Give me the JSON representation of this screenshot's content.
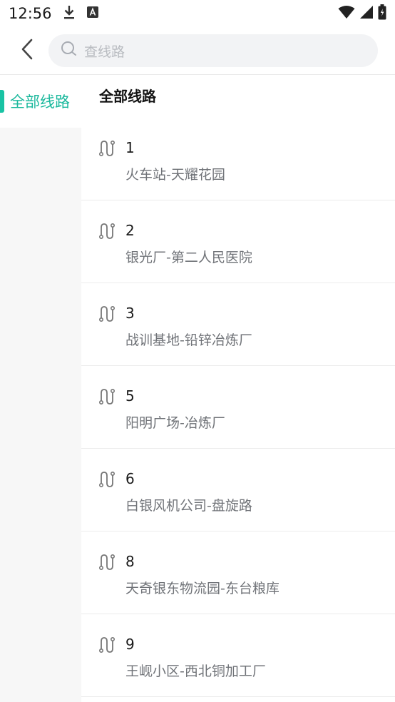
{
  "status_bar": {
    "time": "12:56",
    "icons": [
      "download-icon",
      "text-a-icon",
      "wifi-icon",
      "signal-icon",
      "battery-icon"
    ]
  },
  "search": {
    "placeholder": "查线路",
    "back_icon": "chevron-left-icon",
    "search_icon": "search-icon"
  },
  "sidebar": {
    "items": [
      {
        "label": "全部线路",
        "selected": true
      }
    ]
  },
  "main": {
    "title": "全部线路",
    "routes": [
      {
        "number": "1",
        "desc": "火车站-天耀花园"
      },
      {
        "number": "2",
        "desc": "银光厂-第二人民医院"
      },
      {
        "number": "3",
        "desc": "战训基地-铅锌冶炼厂"
      },
      {
        "number": "5",
        "desc": "阳明广场-冶炼厂"
      },
      {
        "number": "6",
        "desc": "白银风机公司-盘旋路"
      },
      {
        "number": "8",
        "desc": "天奇银东物流园-东台粮库"
      },
      {
        "number": "9",
        "desc": "王岘小区-西北铜加工厂"
      }
    ]
  },
  "colors": {
    "accent": "#19c3a4",
    "sidebar_bg": "#f7f7f7",
    "search_bg": "#f2f3f5"
  }
}
